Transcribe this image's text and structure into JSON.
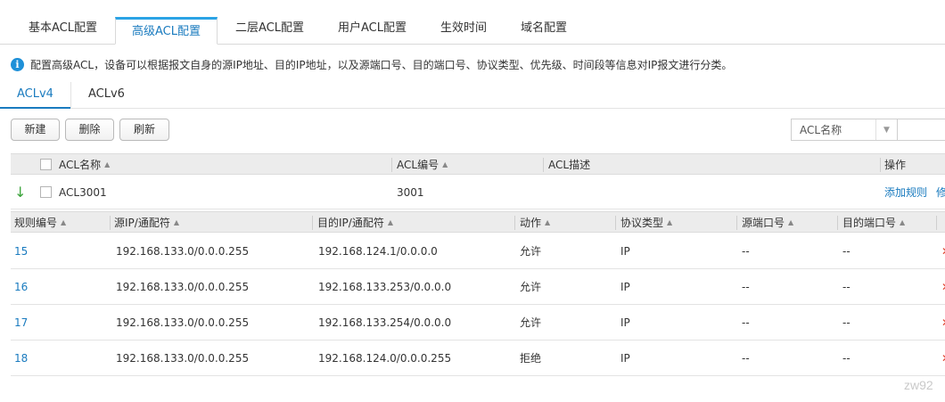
{
  "top_tabs": [
    {
      "label": "基本ACL配置",
      "active": false
    },
    {
      "label": "高级ACL配置",
      "active": true
    },
    {
      "label": "二层ACL配置",
      "active": false
    },
    {
      "label": "用户ACL配置",
      "active": false
    },
    {
      "label": "生效时间",
      "active": false
    },
    {
      "label": "域名配置",
      "active": false
    }
  ],
  "info": {
    "icon": "info-icon",
    "text": "配置高级ACL，设备可以根据报文自身的源IP地址、目的IP地址，以及源端口号、目的端口号、协议类型、优先级、时间段等信息对IP报文进行分类。"
  },
  "sub_tabs": [
    {
      "label": "ACLv4",
      "active": true
    },
    {
      "label": "ACLv6",
      "active": false
    }
  ],
  "toolbar": {
    "new_label": "新建",
    "delete_label": "删除",
    "refresh_label": "刷新",
    "search_field": "ACL名称"
  },
  "acl_table": {
    "columns": [
      "ACL名称",
      "ACL编号",
      "ACL描述",
      "操作"
    ],
    "rows": [
      {
        "name": "ACL3001",
        "number": "3001",
        "description": "",
        "action_add": "添加规则",
        "action_edit": "修"
      }
    ]
  },
  "rule_table": {
    "columns": [
      "规则编号",
      "源IP/通配符",
      "目的IP/通配符",
      "动作",
      "协议类型",
      "源端口号",
      "目的端口号"
    ],
    "rows": [
      {
        "id": "15",
        "src": "192.168.133.0/0.0.0.255",
        "dst": "192.168.124.1/0.0.0.0",
        "action": "允许",
        "protocol": "IP",
        "src_port": "--",
        "dst_port": "--"
      },
      {
        "id": "16",
        "src": "192.168.133.0/0.0.0.255",
        "dst": "192.168.133.253/0.0.0.0",
        "action": "允许",
        "protocol": "IP",
        "src_port": "--",
        "dst_port": "--"
      },
      {
        "id": "17",
        "src": "192.168.133.0/0.0.0.255",
        "dst": "192.168.133.254/0.0.0.0",
        "action": "允许",
        "protocol": "IP",
        "src_port": "--",
        "dst_port": "--"
      },
      {
        "id": "18",
        "src": "192.168.133.0/0.0.0.255",
        "dst": "192.168.124.0/0.0.0.255",
        "action": "拒绝",
        "protocol": "IP",
        "src_port": "--",
        "dst_port": "--"
      }
    ]
  },
  "watermark": "zw92"
}
